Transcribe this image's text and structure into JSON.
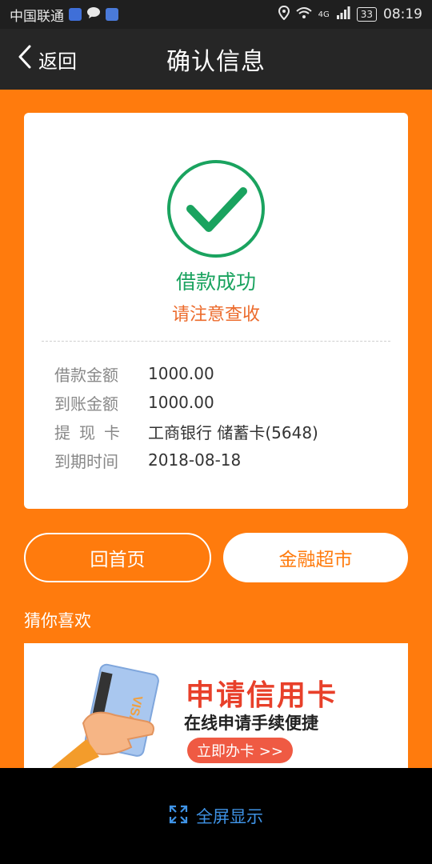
{
  "status_bar": {
    "carrier": "中国联通",
    "network": "4G",
    "battery": "33",
    "time": "08:19"
  },
  "nav": {
    "back_label": "返回",
    "title": "确认信息"
  },
  "result": {
    "status": "借款成功",
    "notice": "请注意查收"
  },
  "details": [
    {
      "label": "借款金额",
      "value": "1000.00"
    },
    {
      "label": "到账金额",
      "value": "1000.00"
    },
    {
      "label": "提现卡",
      "value": "工商银行 储蓄卡(5648)"
    },
    {
      "label": "到期时间",
      "value": "2018-08-18"
    }
  ],
  "buttons": {
    "home": "回首页",
    "market": "金融超市"
  },
  "recommend": {
    "title": "猜你喜欢",
    "banner_title": "申请信用卡",
    "banner_subtitle": "在线申请手续便捷",
    "banner_cta": "立即办卡 >>",
    "card_brand": "VISA"
  },
  "bottom": {
    "fullscreen_label": "全屏显示"
  },
  "colors": {
    "accent": "#ff7b0d",
    "success": "#1aa35f",
    "notice": "#ec6b2c",
    "link": "#3f93e6"
  }
}
